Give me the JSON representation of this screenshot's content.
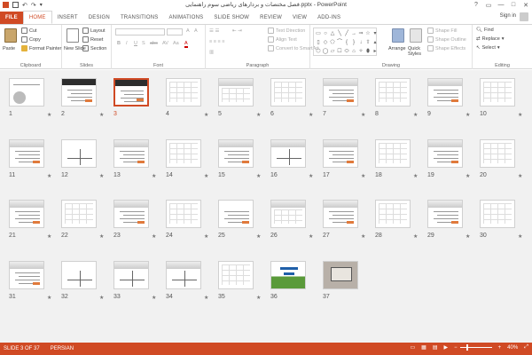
{
  "window": {
    "title": "فصل مختصات و بردارهای ریاضی سوم راهنمایی.pptx - PowerPoint",
    "controls": [
      "?",
      "▭",
      "—",
      "□",
      "✕"
    ]
  },
  "tabs": [
    "FILE",
    "HOME",
    "INSERT",
    "DESIGN",
    "TRANSITIONS",
    "ANIMATIONS",
    "SLIDE SHOW",
    "REVIEW",
    "VIEW",
    "ADD-INS"
  ],
  "active_tab": "HOME",
  "signin": "Sign in",
  "ribbon": {
    "clipboard": {
      "name": "Clipboard",
      "paste": "Paste",
      "cut": "Cut",
      "copy": "Copy",
      "format_painter": "Format Painter"
    },
    "slides": {
      "name": "Slides",
      "new_slide": "New Slide",
      "layout": "Layout",
      "reset": "Reset",
      "section": "Section"
    },
    "font": {
      "name": "Font",
      "buttons": [
        "B",
        "I",
        "U",
        "S",
        "abc",
        "AV",
        "Aa",
        "A"
      ]
    },
    "paragraph": {
      "name": "Paragraph",
      "text_direction": "Text Direction",
      "align_text": "Align Text",
      "convert": "Convert to SmartArt"
    },
    "drawing": {
      "name": "Drawing",
      "arrange": "Arrange",
      "quick_styles": "Quick Styles",
      "shape_fill": "Shape Fill",
      "shape_outline": "Shape Outline",
      "shape_effects": "Shape Effects"
    },
    "editing": {
      "name": "Editing",
      "find": "Find",
      "replace": "Replace",
      "select": "Select"
    }
  },
  "slides": [
    {
      "n": "1",
      "kind": "title-photo",
      "star": "★"
    },
    {
      "n": "2",
      "kind": "dark-text",
      "star": "★"
    },
    {
      "n": "3",
      "kind": "text-banner",
      "star": "",
      "selected": true
    },
    {
      "n": "4",
      "kind": "grid",
      "star": "★"
    },
    {
      "n": "5",
      "kind": "header-grid",
      "star": "★"
    },
    {
      "n": "6",
      "kind": "grid",
      "star": "★"
    },
    {
      "n": "7",
      "kind": "header-text",
      "star": "★"
    },
    {
      "n": "8",
      "kind": "grid",
      "star": "★"
    },
    {
      "n": "9",
      "kind": "header-text",
      "star": "★"
    },
    {
      "n": "10",
      "kind": "grid",
      "star": "★"
    },
    {
      "n": "11",
      "kind": "header-text",
      "star": "★"
    },
    {
      "n": "12",
      "kind": "axes",
      "star": "★"
    },
    {
      "n": "13",
      "kind": "header-text",
      "star": "★"
    },
    {
      "n": "14",
      "kind": "grid",
      "star": "★"
    },
    {
      "n": "15",
      "kind": "header-text",
      "star": "★"
    },
    {
      "n": "16",
      "kind": "header-axes",
      "star": "★"
    },
    {
      "n": "17",
      "kind": "header-text",
      "star": "★"
    },
    {
      "n": "18",
      "kind": "grid",
      "star": "★"
    },
    {
      "n": "19",
      "kind": "header-text",
      "star": "★"
    },
    {
      "n": "20",
      "kind": "grid",
      "star": "★"
    },
    {
      "n": "21",
      "kind": "header-text",
      "star": "★"
    },
    {
      "n": "22",
      "kind": "grid",
      "star": "★"
    },
    {
      "n": "23",
      "kind": "header-text",
      "star": "★"
    },
    {
      "n": "24",
      "kind": "grid",
      "star": "★"
    },
    {
      "n": "25",
      "kind": "text",
      "star": "★"
    },
    {
      "n": "26",
      "kind": "header-grid",
      "star": "★"
    },
    {
      "n": "27",
      "kind": "header-text",
      "star": "★"
    },
    {
      "n": "28",
      "kind": "grid",
      "star": "★"
    },
    {
      "n": "29",
      "kind": "header-text",
      "star": "★"
    },
    {
      "n": "30",
      "kind": "grid",
      "star": "★"
    },
    {
      "n": "31",
      "kind": "header-text",
      "star": "★"
    },
    {
      "n": "32",
      "kind": "axes",
      "star": "★"
    },
    {
      "n": "33",
      "kind": "header-axes",
      "star": "★"
    },
    {
      "n": "34",
      "kind": "header-axes",
      "star": "★"
    },
    {
      "n": "35",
      "kind": "grid",
      "star": "★"
    },
    {
      "n": "36",
      "kind": "cartoon",
      "star": ""
    },
    {
      "n": "37",
      "kind": "laptop",
      "star": ""
    }
  ],
  "status": {
    "slide": "SLIDE 3 OF 37",
    "language": "PERSIAN",
    "zoom": "40%"
  }
}
